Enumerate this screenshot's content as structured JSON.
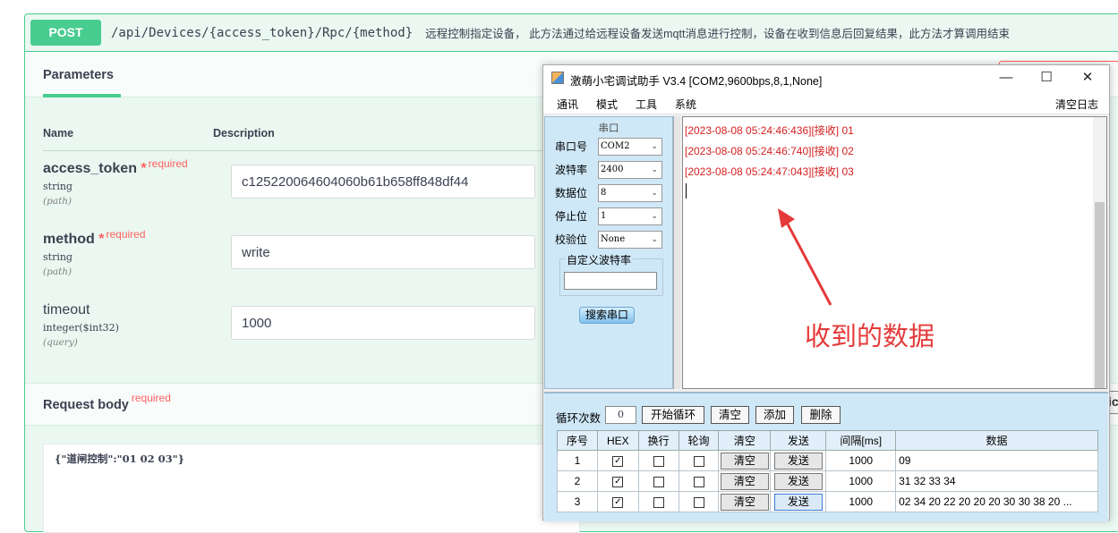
{
  "swagger": {
    "method": "POST",
    "path": "/api/Devices/{access_token}/Rpc/{method}",
    "description": "远程控制指定设备，  此方法通过给远程设备发送mqtt消息进行控制，设备在收到信息后回复结果，此方法才算调用结束",
    "params_tab": "Parameters",
    "col_name": "Name",
    "col_description": "Description",
    "params": [
      {
        "name": "access_token",
        "star": "*",
        "required": "required",
        "type": "string",
        "in": "(path)",
        "value": "c125220064604060b61b658ff848df44"
      },
      {
        "name": "method",
        "star": "*",
        "required": "required",
        "type": "string",
        "in": "(path)",
        "value": "write"
      },
      {
        "name": "timeout",
        "type": "integer($int32)",
        "in": "(query)",
        "value": "1000"
      }
    ],
    "request_body_title": "Request body",
    "request_body_required": "required",
    "request_body_json": "{\"道闸控制\":\"01 02 03\"}",
    "clipped_button_text": "ic"
  },
  "tool": {
    "title": "激萌小宅调试助手 V3.4  [COM2,9600bps,8,1,None]",
    "window_buttons": {
      "minimize": "—",
      "maximize": "☐",
      "close": "✕"
    },
    "menu": [
      "通讯",
      "模式",
      "工具",
      "系统"
    ],
    "clear_log": "清空日志",
    "serial": {
      "panel_title": "串口",
      "fields": [
        {
          "label": "串口号",
          "value": "COM2"
        },
        {
          "label": "波特率",
          "value": "2400"
        },
        {
          "label": "数据位",
          "value": "8"
        },
        {
          "label": "停止位",
          "value": "1"
        },
        {
          "label": "校验位",
          "value": "None"
        }
      ],
      "custom_baud_label": "自定义波特率",
      "search_button": "搜索串口"
    },
    "log_lines": [
      "[2023-08-08 05:24:46:436][接收] 01",
      "[2023-08-08 05:24:46:740][接收] 02",
      "[2023-08-08 05:24:47:043][接收] 03"
    ],
    "annotation": "收到的数据",
    "annotation_color": "#e53a3a",
    "loop": {
      "label": "循环次数",
      "value": "0",
      "buttons": [
        "开始循环",
        "清空",
        "添加",
        "删除"
      ]
    },
    "grid": {
      "headers": [
        "序号",
        "HEX",
        "换行",
        "轮询",
        "清空",
        "发送",
        "间隔[ms]",
        "数据"
      ],
      "rows": [
        {
          "index": "1",
          "hex": true,
          "newline": false,
          "poll": false,
          "clear": "清空",
          "send": "发送",
          "interval": "1000",
          "data": "09"
        },
        {
          "index": "2",
          "hex": true,
          "newline": false,
          "poll": false,
          "clear": "清空",
          "send": "发送",
          "interval": "1000",
          "data": "31 32 33 34"
        },
        {
          "index": "3",
          "hex": true,
          "newline": false,
          "poll": false,
          "clear": "清空",
          "send": "发送",
          "interval": "1000",
          "data": "02 34 20 22 20 20 20 30 30 38 20 ..."
        }
      ]
    }
  }
}
